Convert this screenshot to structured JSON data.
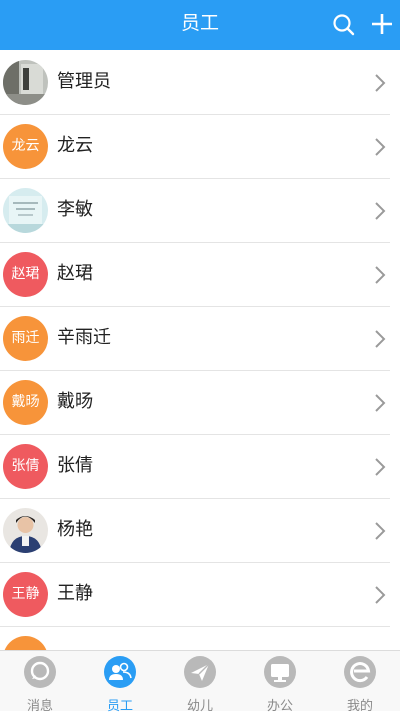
{
  "header": {
    "title": "员工"
  },
  "employees": [
    {
      "name": "管理员",
      "avatar_text": "",
      "avatar_type": "photo-room"
    },
    {
      "name": "龙云",
      "avatar_text": "龙云",
      "avatar_color": "#f7943a"
    },
    {
      "name": "李敏",
      "avatar_text": "",
      "avatar_type": "photo-card"
    },
    {
      "name": "赵珺",
      "avatar_text": "赵珺",
      "avatar_color": "#ef5a5f"
    },
    {
      "name": "辛雨迁",
      "avatar_text": "雨迁",
      "avatar_color": "#f7943a"
    },
    {
      "name": "戴旸",
      "avatar_text": "戴旸",
      "avatar_color": "#f7943a"
    },
    {
      "name": "张倩",
      "avatar_text": "张倩",
      "avatar_color": "#ef5a5f"
    },
    {
      "name": "杨艳",
      "avatar_text": "",
      "avatar_type": "photo-person"
    },
    {
      "name": "王静",
      "avatar_text": "王静",
      "avatar_color": "#ef5a5f"
    },
    {
      "name": "",
      "avatar_text": "",
      "avatar_color": "#f7943a"
    }
  ],
  "tabs": [
    {
      "label": "消息",
      "icon": "message-icon",
      "active": false
    },
    {
      "label": "员工",
      "icon": "staff-icon",
      "active": true
    },
    {
      "label": "幼儿",
      "icon": "paper-plane-icon",
      "active": false
    },
    {
      "label": "办公",
      "icon": "monitor-icon",
      "active": false
    },
    {
      "label": "我的",
      "icon": "profile-e-icon",
      "active": false
    }
  ],
  "colors": {
    "accent": "#2a9df4",
    "orange": "#f7943a",
    "red": "#ef5a5f",
    "inactive": "#b9b9b9"
  }
}
